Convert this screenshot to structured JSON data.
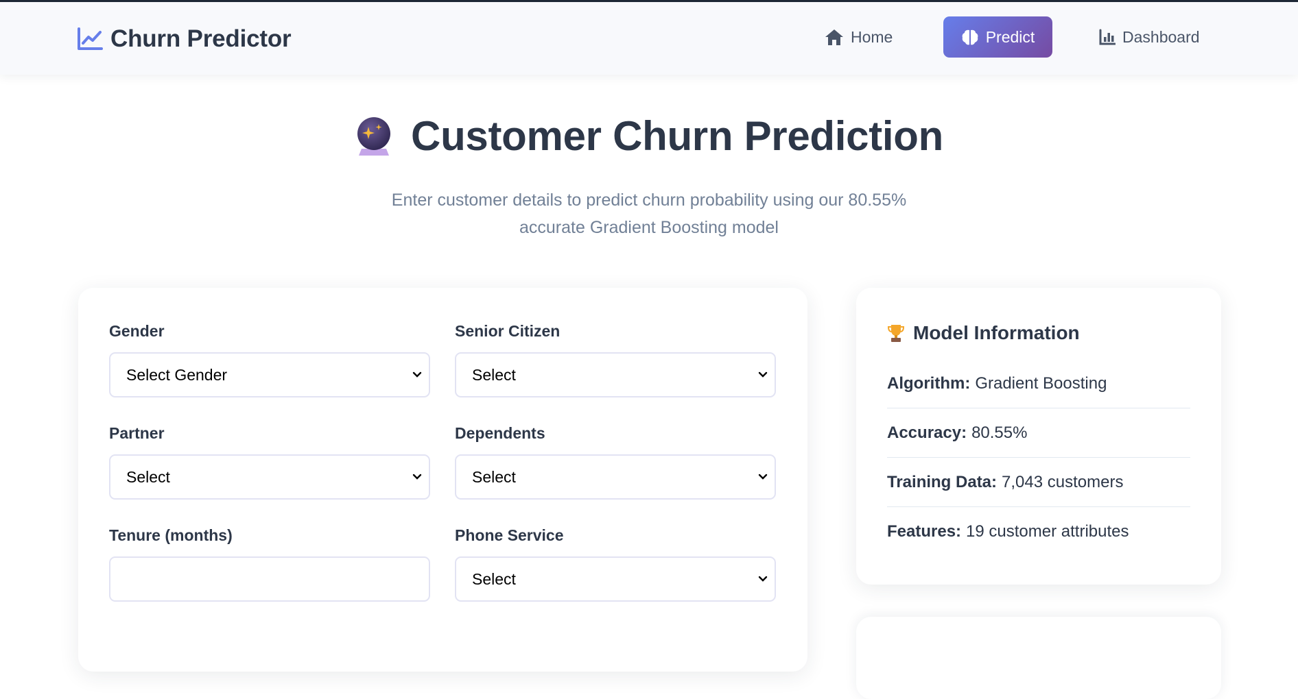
{
  "colors": {
    "accent_start": "#667eea",
    "accent_end": "#764ba2",
    "text_dark": "#2d3748",
    "text_muted": "#718096"
  },
  "navbar": {
    "brand": {
      "icon": "line-chart-icon",
      "label": "Churn Predictor"
    },
    "links": [
      {
        "icon": "home-icon",
        "label": "Home",
        "active": false
      },
      {
        "icon": "brain-icon",
        "label": "Predict",
        "active": true
      },
      {
        "icon": "bar-chart-icon",
        "label": "Dashboard",
        "active": false
      }
    ]
  },
  "hero": {
    "icon": "crystal-ball-icon",
    "title": "Customer Churn Prediction",
    "subtitle_line1": "Enter customer details to predict churn probability using our 80.55%",
    "subtitle_line2": "accurate Gradient Boosting model"
  },
  "form": {
    "fields": [
      {
        "label": "Gender",
        "type": "select",
        "value": "Select Gender"
      },
      {
        "label": "Senior Citizen",
        "type": "select",
        "value": "Select"
      },
      {
        "label": "Partner",
        "type": "select",
        "value": "Select"
      },
      {
        "label": "Dependents",
        "type": "select",
        "value": "Select"
      },
      {
        "label": "Tenure (months)",
        "type": "input",
        "value": ""
      },
      {
        "label": "Phone Service",
        "type": "select",
        "value": "Select"
      }
    ]
  },
  "model_info": {
    "icon": "trophy-icon",
    "title": "Model Information",
    "rows": [
      {
        "label": "Algorithm:",
        "value": "Gradient Boosting"
      },
      {
        "label": "Accuracy:",
        "value": "80.55%"
      },
      {
        "label": "Training Data:",
        "value": "7,043 customers"
      },
      {
        "label": "Features:",
        "value": "19 customer attributes"
      }
    ]
  }
}
